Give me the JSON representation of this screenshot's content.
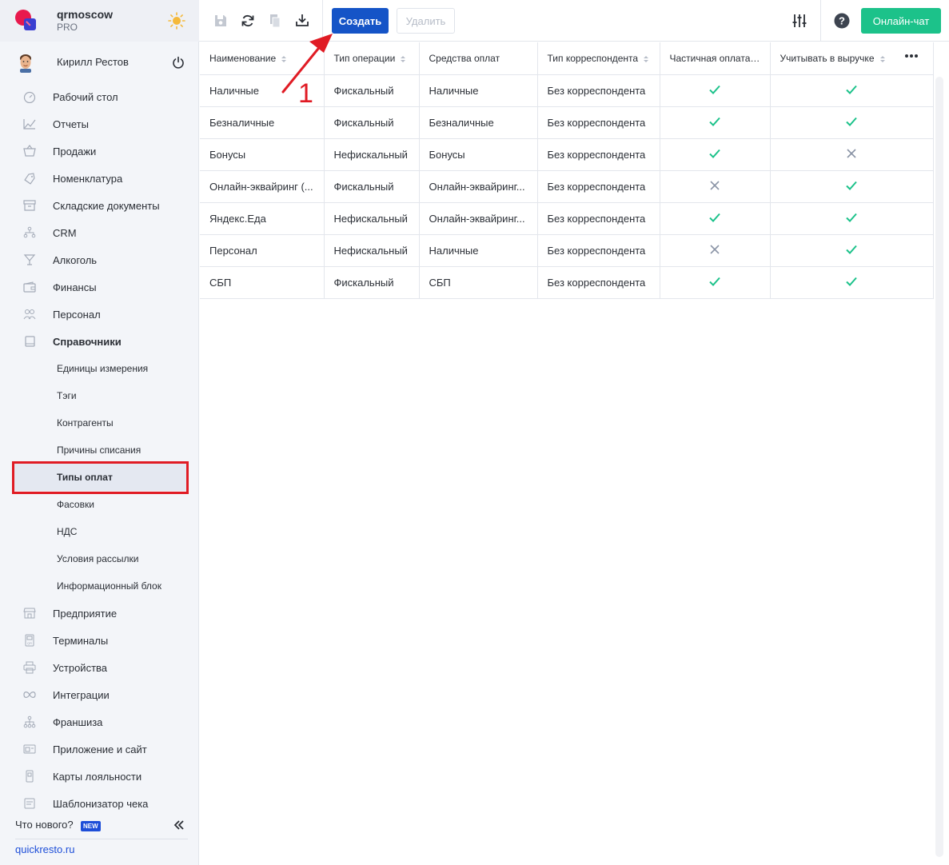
{
  "brand": {
    "name": "qrmoscow",
    "plan": "PRO"
  },
  "user": {
    "name": "Кирилл Рестов"
  },
  "sidebar": {
    "items": [
      {
        "label": "Рабочий стол",
        "icon": "dashboard-icon"
      },
      {
        "label": "Отчеты",
        "icon": "reports-icon"
      },
      {
        "label": "Продажи",
        "icon": "cart-icon"
      },
      {
        "label": "Номенклатура",
        "icon": "tag-icon"
      },
      {
        "label": "Складские документы",
        "icon": "archive-icon"
      },
      {
        "label": "CRM",
        "icon": "crm-icon"
      },
      {
        "label": "Алкоголь",
        "icon": "glass-icon"
      },
      {
        "label": "Финансы",
        "icon": "wallet-icon"
      },
      {
        "label": "Персонал",
        "icon": "people-icon"
      },
      {
        "label": "Справочники",
        "icon": "book-icon"
      }
    ],
    "sub_items": [
      {
        "label": "Единицы измерения"
      },
      {
        "label": "Тэги"
      },
      {
        "label": "Контрагенты"
      },
      {
        "label": "Причины списания"
      },
      {
        "label": "Типы оплат"
      },
      {
        "label": "Фасовки"
      },
      {
        "label": "НДС"
      },
      {
        "label": "Условия рассылки"
      },
      {
        "label": "Информационный блок"
      }
    ],
    "items_after": [
      {
        "label": "Предприятие",
        "icon": "store-icon"
      },
      {
        "label": "Терминалы",
        "icon": "terminal-icon"
      },
      {
        "label": "Устройства",
        "icon": "printer-icon"
      },
      {
        "label": "Интеграции",
        "icon": "infinity-icon"
      },
      {
        "label": "Франшиза",
        "icon": "hierarchy-icon"
      },
      {
        "label": "Приложение и сайт",
        "icon": "app-icon"
      },
      {
        "label": "Карты лояльности",
        "icon": "card-icon"
      },
      {
        "label": "Шаблонизатор чека",
        "icon": "receipt-icon"
      }
    ],
    "whats_new": "Что нового?",
    "new_badge": "NEW",
    "site": "quickresto.ru"
  },
  "toolbar": {
    "create_label": "Создать",
    "delete_label": "Удалить",
    "chat_label": "Онлайн-чат"
  },
  "annotation": {
    "number": "1",
    "color": "#e01b24"
  },
  "table": {
    "columns": [
      "Наименование",
      "Тип операции",
      "Средства оплат",
      "Тип корреспондента",
      "Частичная оплата",
      "Учитывать в выручке"
    ],
    "rows": [
      {
        "name": "Наличные",
        "op": "Фискальный",
        "means": "Наличные",
        "corr": "Без корреспондента",
        "partial": true,
        "revenue": true
      },
      {
        "name": "Безналичные",
        "op": "Фискальный",
        "means": "Безналичные",
        "corr": "Без корреспондента",
        "partial": true,
        "revenue": true
      },
      {
        "name": "Бонусы",
        "op": "Нефискальный",
        "means": "Бонусы",
        "corr": "Без корреспондента",
        "partial": true,
        "revenue": false
      },
      {
        "name": "Онлайн-эквайринг (...",
        "op": "Фискальный",
        "means": "Онлайн-эквайринг...",
        "corr": "Без корреспондента",
        "partial": false,
        "revenue": true
      },
      {
        "name": "Яндекс.Еда",
        "op": "Нефискальный",
        "means": "Онлайн-эквайринг...",
        "corr": "Без корреспондента",
        "partial": true,
        "revenue": true
      },
      {
        "name": "Персонал",
        "op": "Нефискальный",
        "means": "Наличные",
        "corr": "Без корреспондента",
        "partial": false,
        "revenue": true
      },
      {
        "name": "СБП",
        "op": "Фискальный",
        "means": "СБП",
        "corr": "Без корреспондента",
        "partial": true,
        "revenue": true
      }
    ]
  },
  "colors": {
    "check": "#1cc28a",
    "cross": "#8a94a6",
    "primary": "#1554c7",
    "accent": "#1cc28a"
  }
}
